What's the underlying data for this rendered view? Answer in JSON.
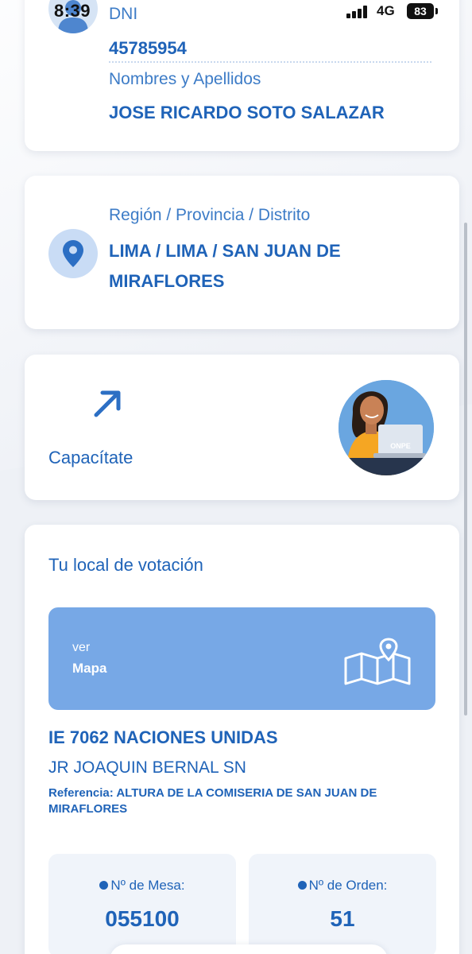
{
  "status_bar": {
    "time": "8:39",
    "network": "4G",
    "battery": "83"
  },
  "person": {
    "dni_label": "DNI",
    "dni_value": "45785954",
    "names_label": "Nombres y Apellidos",
    "names_value": "JOSE RICARDO SOTO SALAZAR"
  },
  "location": {
    "label": "Región / Provincia / Distrito",
    "value": "LIMA / LIMA / SAN JUAN DE MIRAFLORES"
  },
  "training": {
    "label": "Capacítate",
    "laptop_brand": "ONPE"
  },
  "voting": {
    "title": "Tu local de votación",
    "map_button": {
      "ver": "ver",
      "label": "Mapa"
    },
    "school_name": "IE 7062 NACIONES UNIDAS",
    "school_address": "JR JOAQUIN BERNAL SN",
    "reference": "Referencia: ALTURA DE LA COMISERIA DE SAN JUAN DE MIRAFLORES",
    "mesa_label": "Nº de Mesa:",
    "mesa_value": "055100",
    "orden_label": "Nº de Orden:",
    "orden_value": "51"
  },
  "colors": {
    "primary": "#1f63b8",
    "accent": "#77a8e6",
    "background": "#eef1f6"
  }
}
